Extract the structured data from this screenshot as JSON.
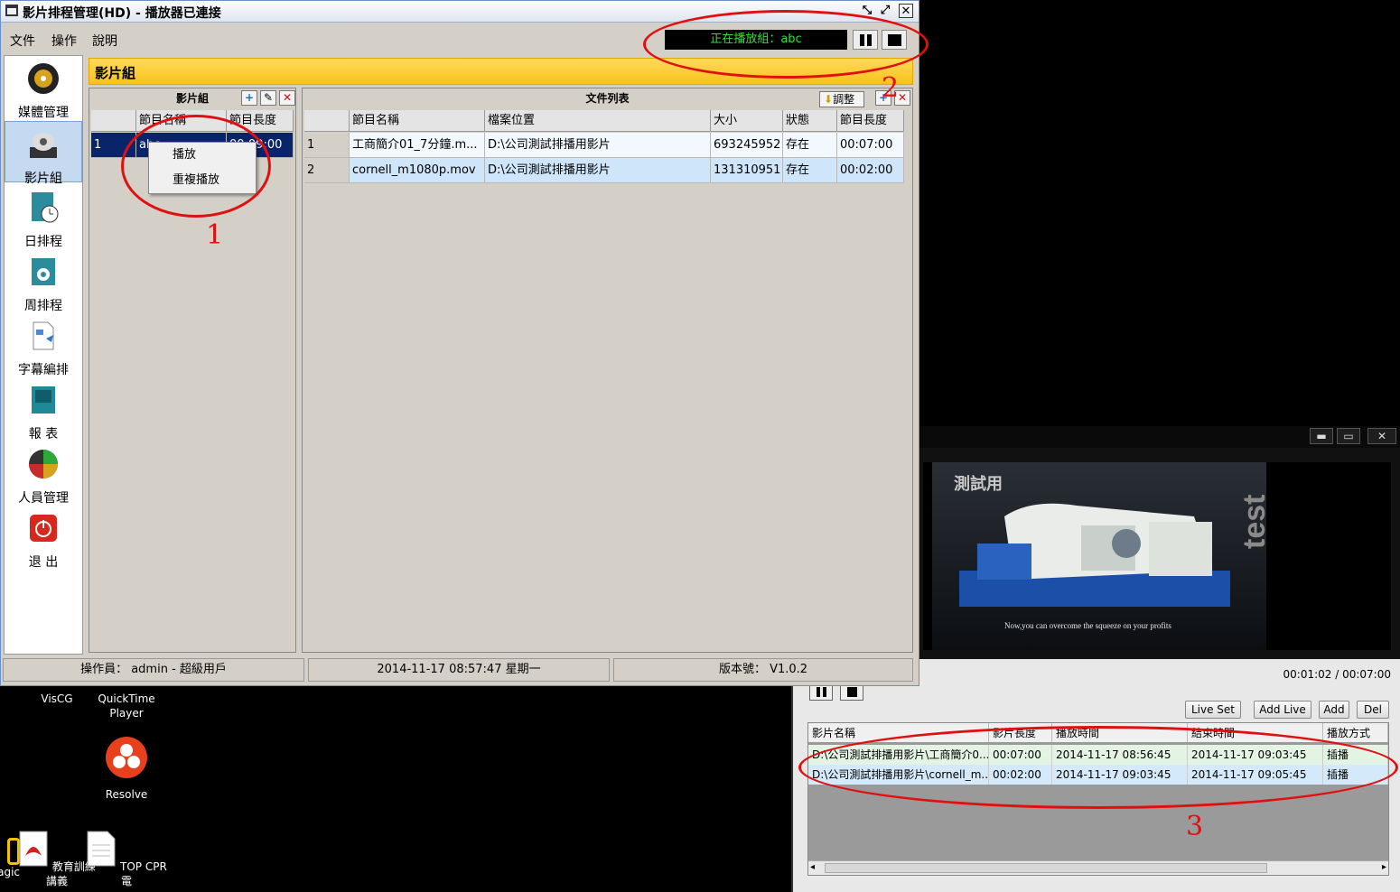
{
  "main_window": {
    "title": "影片排程管理(HD) - 播放器已連接",
    "menu": [
      "文件",
      "操作",
      "說明"
    ],
    "now_playing": "正在播放組：abc",
    "header": "影片組"
  },
  "sidebar": {
    "items": [
      {
        "label": "媒體管理",
        "icon": "media-disc-icon"
      },
      {
        "label": "影片組",
        "icon": "video-group-icon"
      },
      {
        "label": "日排程",
        "icon": "daily-schedule-icon"
      },
      {
        "label": "周排程",
        "icon": "weekly-schedule-icon"
      },
      {
        "label": "字幕編排",
        "icon": "subtitle-icon"
      },
      {
        "label": "報 表",
        "icon": "report-icon"
      },
      {
        "label": "人員管理",
        "icon": "user-manage-icon"
      },
      {
        "label": "退 出",
        "icon": "exit-icon"
      }
    ]
  },
  "groups_panel": {
    "title": "影片組",
    "columns": [
      "",
      "節目名稱",
      "節目長度"
    ],
    "rows": [
      [
        "1",
        "abc",
        "00:09:00"
      ]
    ]
  },
  "context_menu": {
    "items": [
      "播放",
      "重複播放"
    ]
  },
  "files_panel": {
    "title": "文件列表",
    "adjust_label": "調整",
    "columns": [
      "",
      "節目名稱",
      "檔案位置",
      "大小",
      "狀態",
      "節目長度"
    ],
    "rows": [
      [
        "1",
        "工商簡介01_7分鐘.m...",
        "D:\\公司測試排播用影片",
        "693245952",
        "存在",
        "00:07:00"
      ],
      [
        "2",
        "cornell_m1080p.mov",
        "D:\\公司測試排播用影片",
        "131310951",
        "存在",
        "00:02:00"
      ]
    ]
  },
  "status_bar": {
    "operator": "操作員： admin - 超級用戶",
    "datetime": "2014-11-17 08:57:47 星期一",
    "version": "版本號： V1.0.2"
  },
  "player": {
    "watermark_tl": "測試用",
    "watermark_r": "test",
    "subtitle": "Now,you can overcome the squeeze on your profits",
    "time": "00:01:02 / 00:07:00",
    "buttons": [
      "Live Set",
      "Add Live",
      "Add",
      "Del"
    ],
    "columns": [
      "影片名稱",
      "影片長度",
      "播放時間",
      "結束時間",
      "播放方式"
    ],
    "rows": [
      [
        "D:\\公司測試排播用影片\\工商簡介0...",
        "00:07:00",
        "2014-11-17 08:56:45",
        "2014-11-17 09:03:45",
        "插播"
      ],
      [
        "D:\\公司測試排播用影片\\cornell_m...",
        "00:02:00",
        "2014-11-17 09:03:45",
        "2014-11-17 09:05:45",
        "插播"
      ]
    ]
  },
  "desktop": {
    "icons": [
      {
        "label": "VisCG"
      },
      {
        "label": "QuickTime Player"
      },
      {
        "label": "Resolve"
      },
      {
        "label": "agic"
      },
      {
        "label": "教育訓練講義"
      },
      {
        "label": "TOP CPR 電"
      }
    ]
  },
  "annotations": [
    "1",
    "2",
    "3"
  ],
  "colors": {
    "header": "#f7c21c",
    "now_playing_text": "#2fe02f",
    "annotation": "#e01010",
    "selection": "#0a246a"
  }
}
